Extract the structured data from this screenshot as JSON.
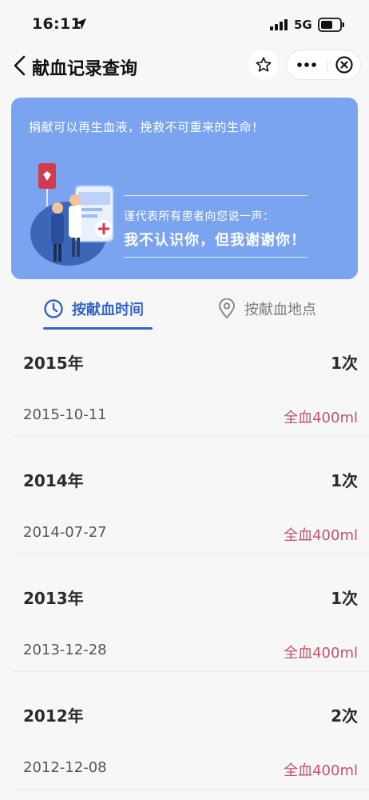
{
  "status_bar": {
    "time": "16:11",
    "network": "5G",
    "icons": [
      "location-arrow-icon",
      "signal-icon",
      "battery-icon"
    ]
  },
  "nav": {
    "title": "献血记录查询",
    "icons": [
      "back-icon",
      "star-icon",
      "more-icon",
      "close-circle-icon"
    ]
  },
  "banner": {
    "top_text": "捐献可以再生血液，挽救不可重来的生命！",
    "sub_text": "谨代表所有患者向您说一声：",
    "main_text": "我不认识你，但我谢谢你！",
    "bg_color": "#7aa4f0"
  },
  "tabs": [
    {
      "label": "按献血时间",
      "icon": "clock-icon",
      "active": true
    },
    {
      "label": "按献血地点",
      "icon": "location-pin-icon",
      "active": false
    }
  ],
  "colors": {
    "accent": "#3565c4",
    "blood_type": "#c0546a"
  },
  "records": [
    {
      "year": "2015年",
      "count": "1次",
      "items": [
        {
          "date": "2015-10-11",
          "type": "全血400ml"
        }
      ]
    },
    {
      "year": "2014年",
      "count": "1次",
      "items": [
        {
          "date": "2014-07-27",
          "type": "全血400ml"
        }
      ]
    },
    {
      "year": "2013年",
      "count": "1次",
      "items": [
        {
          "date": "2013-12-28",
          "type": "全血400ml"
        }
      ]
    },
    {
      "year": "2012年",
      "count": "2次",
      "items": [
        {
          "date": "2012-12-08",
          "type": "全血400ml"
        }
      ]
    }
  ]
}
